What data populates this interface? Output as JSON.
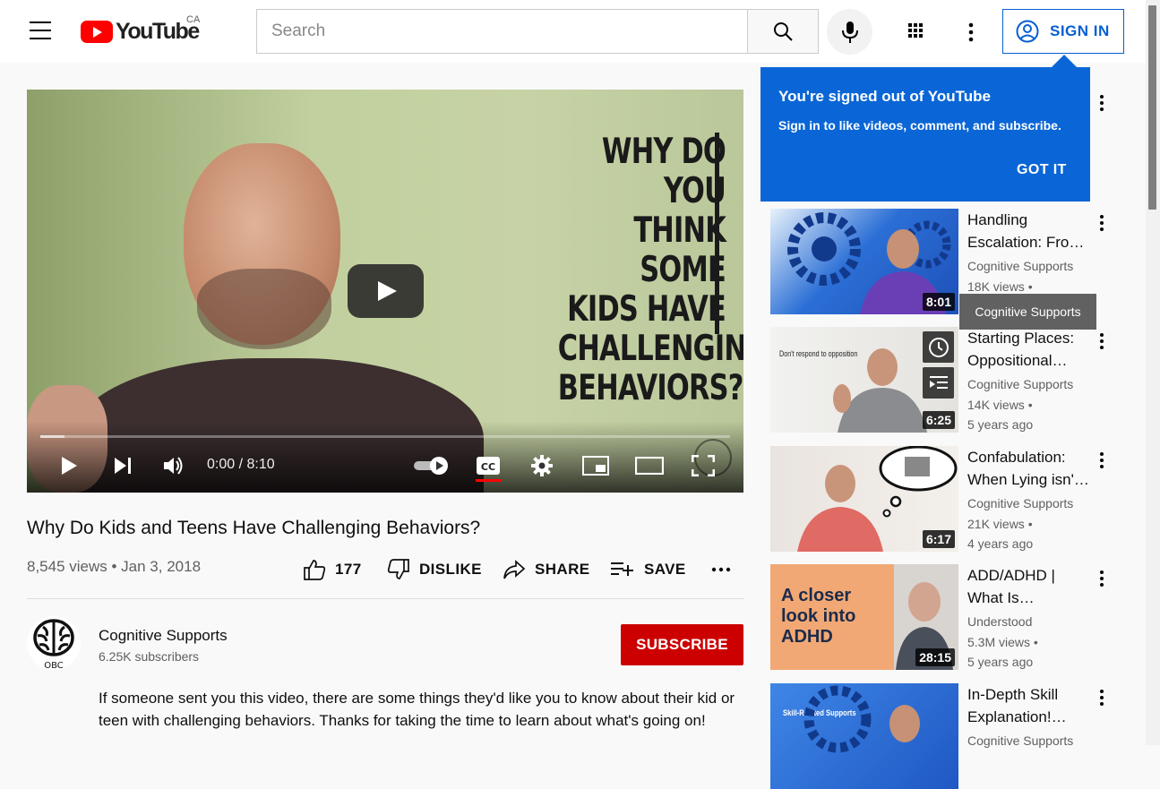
{
  "header": {
    "logo_text": "YouTube",
    "country": "CA",
    "search_placeholder": "Search",
    "signin_label": "SIGN IN"
  },
  "player": {
    "overlay_text": [
      "WHY DO YOU",
      "THINK SOME",
      "KIDS HAVE",
      "CHALLENGING",
      "BEHAVIORS?"
    ],
    "time": "0:00 / 8:10",
    "progress_fraction": 0.035,
    "captions_enabled": true
  },
  "video": {
    "title": "Why Do Kids and Teens Have Challenging Behaviors?",
    "meta": "8,545 views • Jan 3, 2018",
    "likes": "177",
    "dislike_label": "DISLIKE",
    "share_label": "SHARE",
    "save_label": "SAVE"
  },
  "channel": {
    "name": "Cognitive Supports",
    "subscribers": "6.25K subscribers",
    "avatar_text": "OBC",
    "subscribe_label": "SUBSCRIBE"
  },
  "description": "If someone sent you this video, there are some things they'd like you to know about their kid or teen with challenging behaviors. Thanks for taking the time to learn about what's going on!",
  "popup": {
    "title": "You're signed out of YouTube",
    "body": "Sign in to like videos, comment, and subscribe.",
    "button": "GOT IT"
  },
  "tooltip": "Cognitive Supports",
  "recommendations": [
    {
      "title1": "Handling",
      "title2": "Escalation: Fro…",
      "channel": "Cognitive Supports",
      "views": "18K views •",
      "age": "",
      "duration": "8:01",
      "thumb_text": ""
    },
    {
      "title1": "Starting Places:",
      "title2": "Oppositional…",
      "channel": "Cognitive Supports",
      "views": "14K views •",
      "age": "5 years ago",
      "duration": "6:25",
      "thumb_text": "Don't respond to opposition"
    },
    {
      "title1": "Confabulation:",
      "title2": "When Lying isn'…",
      "channel": "Cognitive Supports",
      "views": "21K views •",
      "age": "4 years ago",
      "duration": "6:17",
      "thumb_text": ""
    },
    {
      "title1": "ADD/ADHD |",
      "title2": "What Is…",
      "channel": "Understood",
      "views": "5.3M views •",
      "age": "5 years ago",
      "duration": "28:15",
      "thumb_text": "A closer look into ADHD"
    },
    {
      "title1": "In-Depth Skill",
      "title2": "Explanation!…",
      "channel": "Cognitive Supports",
      "views": "",
      "age": "",
      "duration": "",
      "thumb_text": "Skill-Related Supports"
    }
  ],
  "colors": {
    "brand_red": "#ff0000",
    "link_blue": "#065fd4",
    "popup_blue": "#0a66d6",
    "subscribe_red": "#cc0000"
  }
}
